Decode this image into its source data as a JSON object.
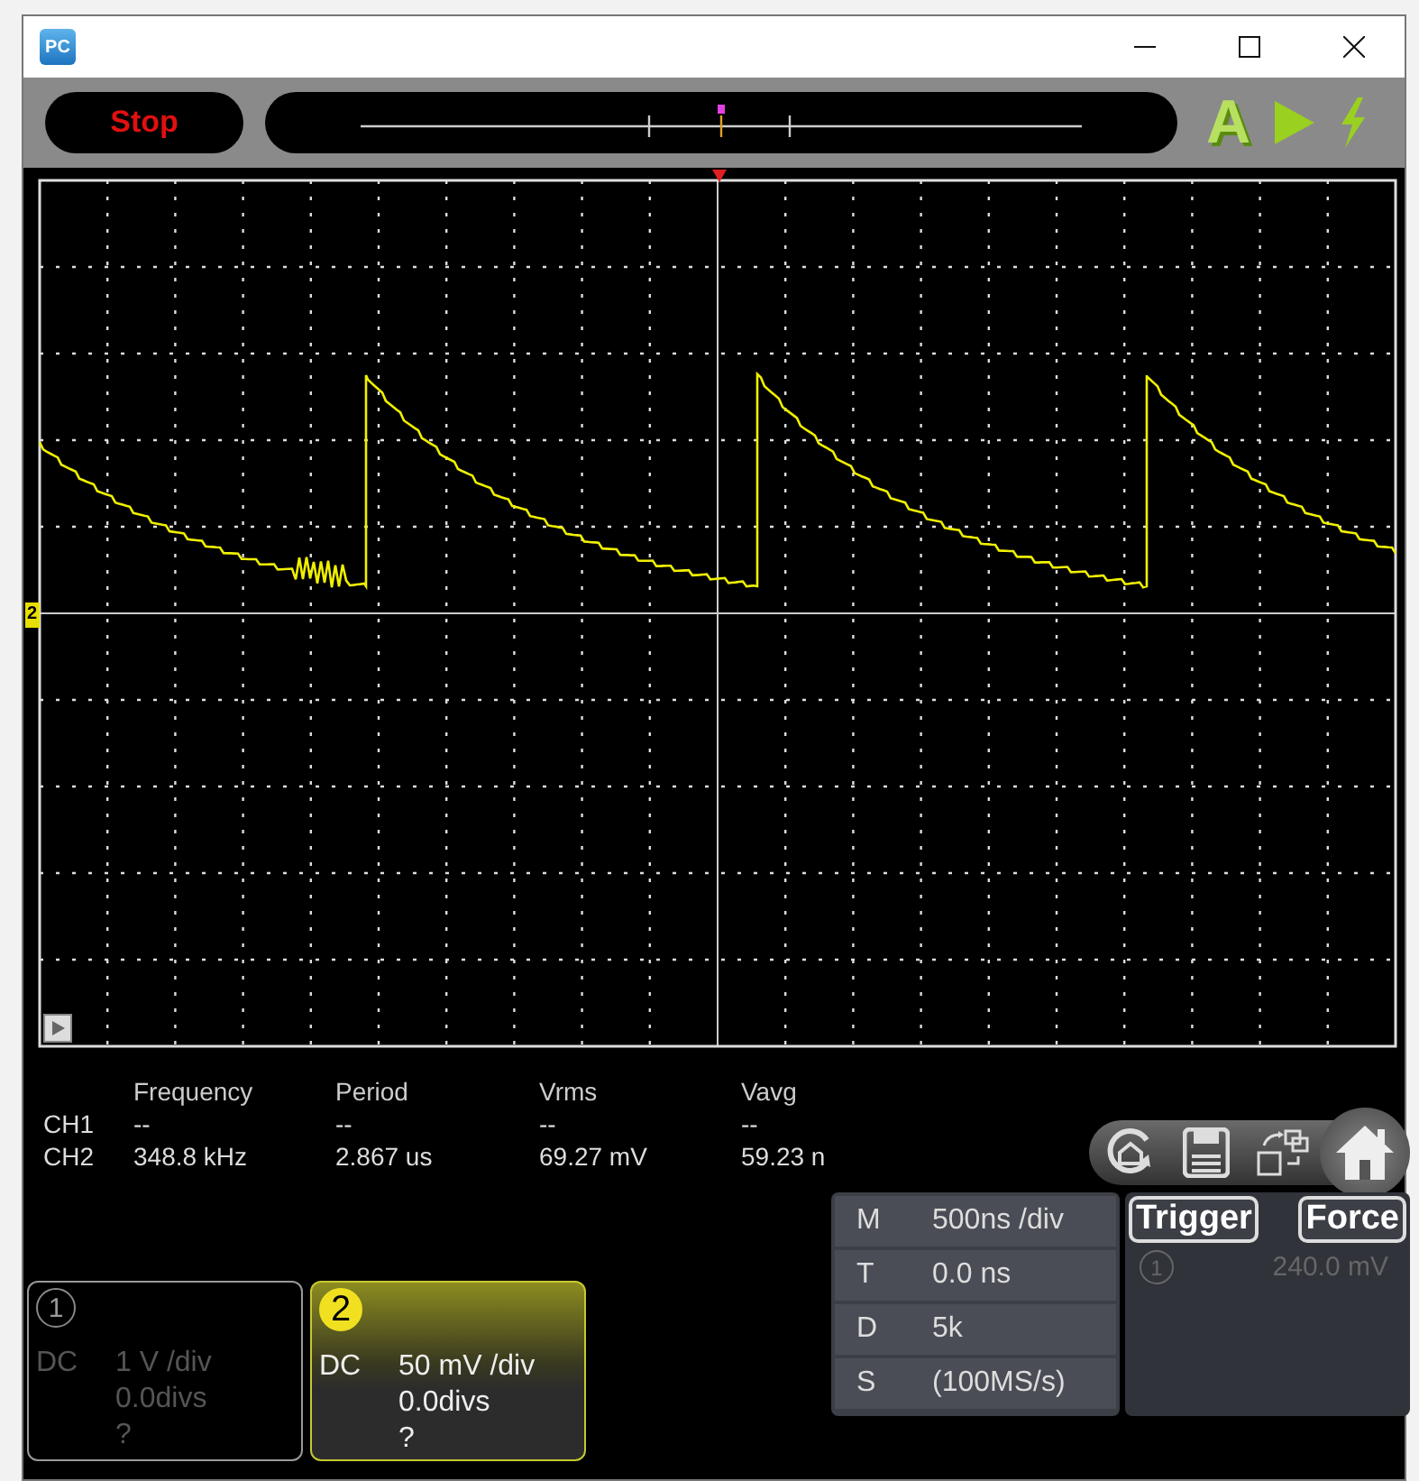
{
  "window": {
    "app_icon_label": "PC"
  },
  "toolbar": {
    "run_button": "Stop",
    "auto_label": "A"
  },
  "scope": {
    "channel_marker": "2"
  },
  "measurements": {
    "columns": [
      "Frequency",
      "Period",
      "Vrms",
      "Vavg"
    ],
    "rows": [
      {
        "channel": "CH1",
        "values": [
          "--",
          "--",
          "--",
          "--"
        ]
      },
      {
        "channel": "CH2",
        "values": [
          "348.8 kHz",
          "2.867 us",
          "69.27 mV",
          "59.23 n"
        ]
      }
    ]
  },
  "channels": [
    {
      "number": "1",
      "selected": false,
      "coupling": "DC",
      "scale": "1 V /div",
      "offset": "0.0divs",
      "probe": "?"
    },
    {
      "number": "2",
      "selected": true,
      "coupling": "DC",
      "scale": "50 mV /div",
      "offset": "0.0divs",
      "probe": "?"
    }
  ],
  "timebase": [
    {
      "key": "M",
      "value": "500ns /div"
    },
    {
      "key": "T",
      "value": "0.0 ns"
    },
    {
      "key": "D",
      "value": "5k"
    },
    {
      "key": "S",
      "value": "(100MS/s)"
    }
  ],
  "trigger": {
    "buttons": [
      "Trigger",
      "Force"
    ],
    "source": "1",
    "trigger_level": "240.0 mV"
  }
}
